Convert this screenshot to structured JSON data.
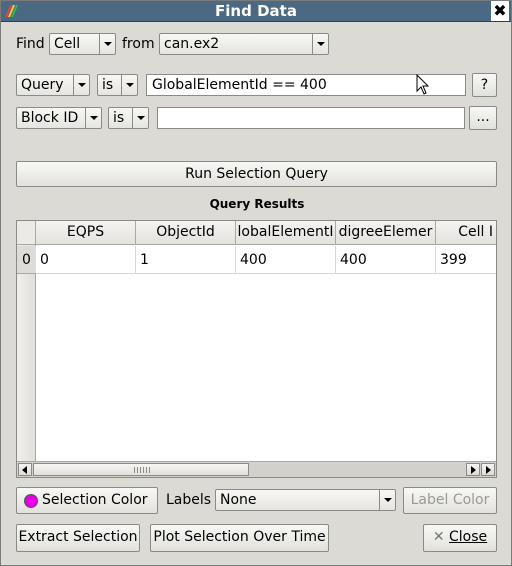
{
  "window": {
    "title": "Find Data",
    "close_glyph": "✖"
  },
  "find_row": {
    "find_label": "Find",
    "element_type": "Cell",
    "from_label": "from",
    "source": "can.ex2"
  },
  "query_row": {
    "field": "Query",
    "operator": "is",
    "value": "GlobalElementId == 400",
    "help_label": "?"
  },
  "block_row": {
    "field": "Block ID",
    "operator": "is",
    "value": "",
    "browse_label": "..."
  },
  "run_button": "Run Selection Query",
  "results": {
    "title": "Query Results",
    "columns": [
      "EQPS",
      "ObjectId",
      "lobalElementI",
      "digreeElemer",
      "Cell I"
    ],
    "rows": [
      {
        "index": "0",
        "cells": [
          "0",
          "1",
          "400",
          "400",
          "399"
        ]
      }
    ]
  },
  "bottom": {
    "selection_color_label": "Selection Color",
    "selection_color": "#e600e6",
    "labels_label": "Labels",
    "labels_value": "None",
    "label_color_label": "Label Color",
    "extract_label": "Extract Selection",
    "plot_label": "Plot Selection Over Time",
    "close_label": "Close",
    "close_icon": "✕"
  }
}
